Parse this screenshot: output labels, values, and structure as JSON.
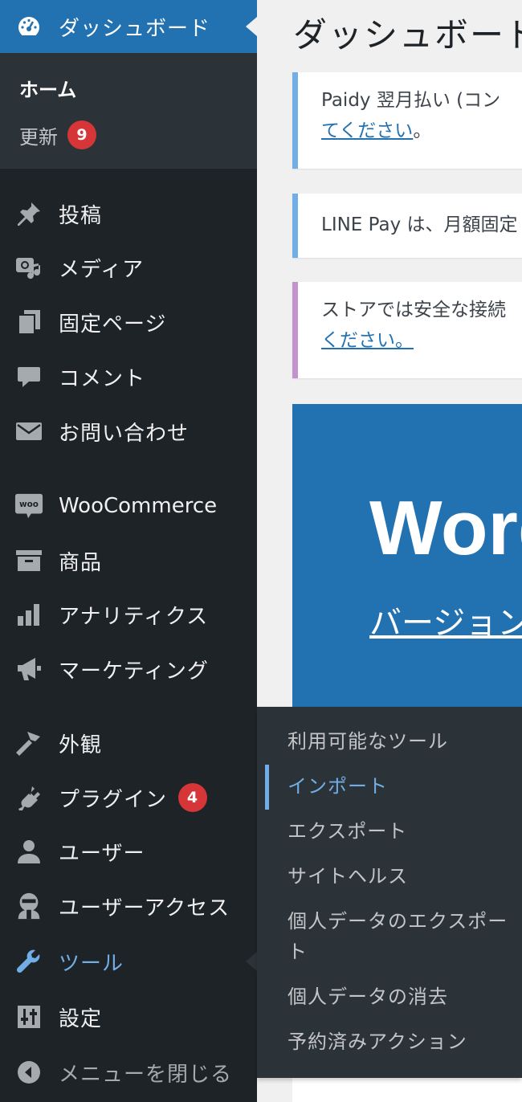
{
  "sidebar": {
    "dashboard_label": "ダッシュボード",
    "submenu": {
      "home": "ホーム",
      "updates": "更新",
      "updates_badge": "9"
    },
    "items": [
      {
        "key": "posts",
        "label": "投稿",
        "icon": "pushpin-icon"
      },
      {
        "key": "media",
        "label": "メディア",
        "icon": "media-icon"
      },
      {
        "key": "pages",
        "label": "固定ページ",
        "icon": "pages-icon"
      },
      {
        "key": "comments",
        "label": "コメント",
        "icon": "comment-icon"
      },
      {
        "key": "contact",
        "label": "お問い合わせ",
        "icon": "mail-icon"
      },
      {
        "key": "woocommerce",
        "label": "WooCommerce",
        "icon": "woo-icon"
      },
      {
        "key": "products",
        "label": "商品",
        "icon": "archive-icon"
      },
      {
        "key": "analytics",
        "label": "アナリティクス",
        "icon": "bar-chart-icon"
      },
      {
        "key": "marketing",
        "label": "マーケティング",
        "icon": "megaphone-icon"
      },
      {
        "key": "appearance",
        "label": "外観",
        "icon": "paintbrush-icon"
      },
      {
        "key": "plugins",
        "label": "プラグイン",
        "icon": "plug-icon",
        "badge": "4"
      },
      {
        "key": "users",
        "label": "ユーザー",
        "icon": "user-icon"
      },
      {
        "key": "user_access",
        "label": "ユーザーアクセス",
        "icon": "guard-icon"
      },
      {
        "key": "tools",
        "label": "ツール",
        "icon": "wrench-icon",
        "active": true
      },
      {
        "key": "settings",
        "label": "設定",
        "icon": "sliders-icon"
      },
      {
        "key": "collapse",
        "label": "メニューを閉じる",
        "icon": "collapse-arrow-icon"
      }
    ]
  },
  "tools_submenu": [
    {
      "label": "利用可能なツール"
    },
    {
      "label": "インポート",
      "current": true
    },
    {
      "label": "エクスポート"
    },
    {
      "label": "サイトヘルス"
    },
    {
      "label": "個人データのエクスポート"
    },
    {
      "label": "個人データの消去"
    },
    {
      "label": "予約済みアクション"
    }
  ],
  "main": {
    "title": "ダッシュボード",
    "notices": [
      {
        "line1": "Paidy 翌月払い (コン",
        "link": "てください",
        "after": "。",
        "color": "#72aee6"
      },
      {
        "line1": "LINE Pay は、月額固定",
        "color": "#72aee6"
      },
      {
        "line1": "ストアでは安全な接続",
        "link": "ください。",
        "color": "#c493cf"
      }
    ],
    "welcome": {
      "headline": "Word",
      "version_link": "バージョン"
    }
  },
  "colors": {
    "sidebar_bg": "#1d2327",
    "active_blue": "#2271b1",
    "badge_red": "#d63638",
    "link_blue": "#72aee6"
  }
}
